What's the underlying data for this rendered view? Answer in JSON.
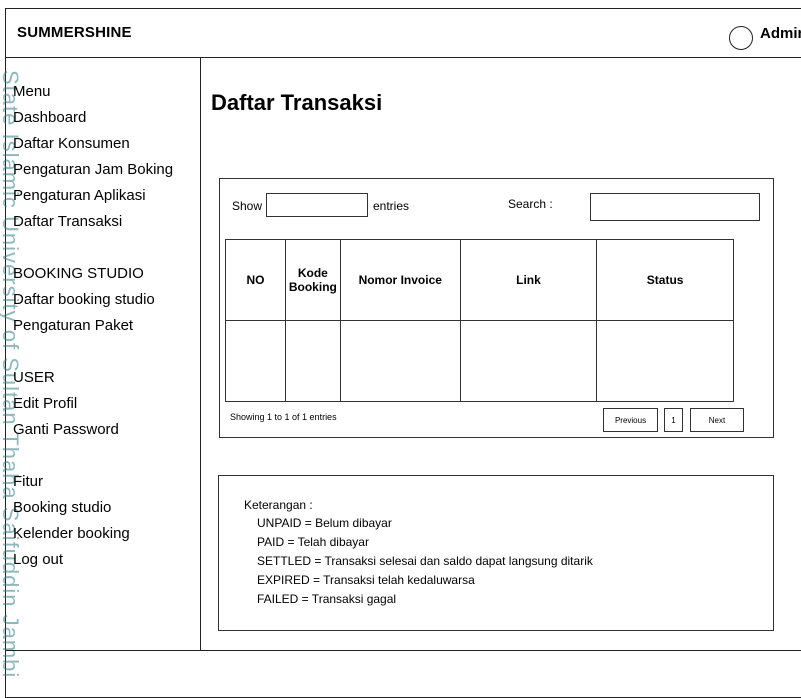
{
  "header": {
    "brand": "SUMMERSHINE",
    "user": "Admin"
  },
  "watermark": "State Islamic University of Sultan Thaha Saifuddin Jambi",
  "sidebar": {
    "lines": [
      "Menu",
      "Dashboard",
      "Daftar Konsumen",
      "Pengaturan Jam Boking",
      "Pengaturan Aplikasi",
      "Daftar Transaksi",
      "BOOKING STUDIO",
      "Daftar booking studio",
      "Pengaturan Paket",
      "USER",
      "Edit Profil",
      "Ganti Password",
      "Fitur",
      "Booking studio",
      "Kelender booking",
      "Log out"
    ]
  },
  "main": {
    "title": "Daftar Transaksi",
    "show_label": "Show",
    "entries_label": "entries",
    "search_label": "Search :",
    "columns": [
      "NO",
      "Kode Booking",
      "Nomor Invoice",
      "Link",
      "Status"
    ],
    "showing": "Showing 1 to 1 of 1 entries",
    "pagination": {
      "previous": "Previous",
      "page": "1",
      "next": "Next"
    }
  },
  "notes": {
    "title": "Keterangan :",
    "items": [
      "UNPAID = Belum dibayar",
      "PAID = Telah dibayar",
      "SETTLED = Transaksi selesai dan saldo dapat langsung ditarik",
      "EXPIRED = Transaksi telah kedaluwarsa",
      "FAILED = Transaksi gagal"
    ]
  }
}
